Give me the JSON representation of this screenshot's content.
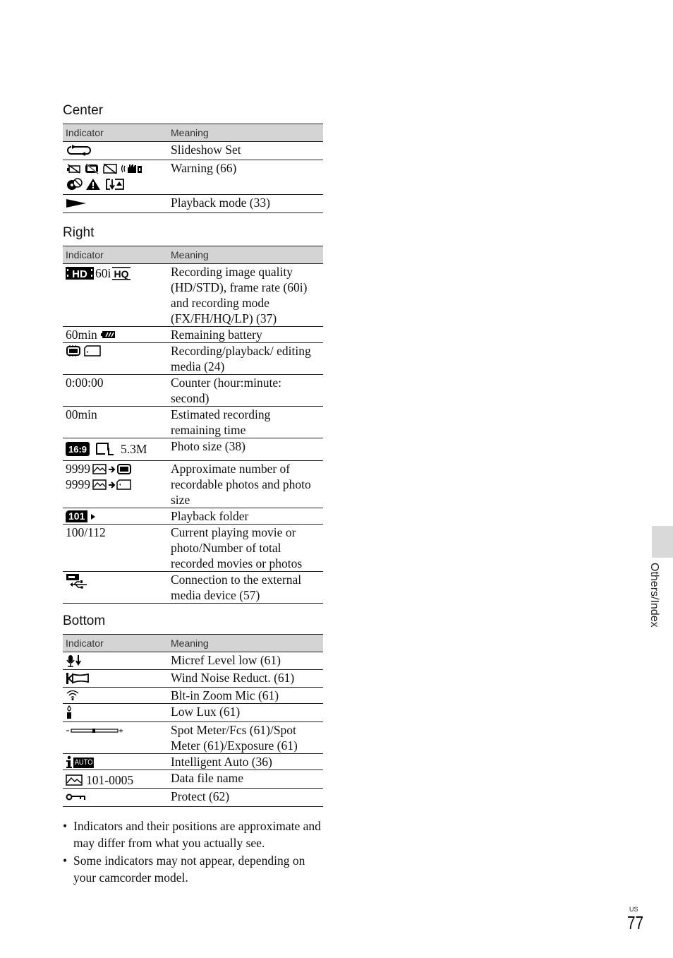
{
  "sections": {
    "center": {
      "title": "Center",
      "header": {
        "indicator": "Indicator",
        "meaning": "Meaning"
      },
      "rows": [
        {
          "icons": [
            "slideshow-repeat-icon"
          ],
          "meaning": "Slideshow Set"
        },
        {
          "icons": [
            "battery-warning-icon",
            "memory-warning-icon",
            "card-warning-icon",
            "camera-shake-warning-icon",
            "disc-warning-icon",
            "warning-triangle-icon",
            "media-warning-icon"
          ],
          "meaning": "Warning (66)"
        },
        {
          "icons": [
            "play-icon"
          ],
          "meaning": "Playback mode (33)"
        }
      ]
    },
    "right": {
      "title": "Right",
      "header": {
        "indicator": "Indicator",
        "meaning": "Meaning"
      },
      "rows": [
        {
          "text": "60i",
          "icons": [
            "hd-icon",
            "hq-mode-icon"
          ],
          "meaning": "Recording image quality (HD/STD), frame rate (60i) and recording mode (FX/FH/HQ/LP) (37)"
        },
        {
          "text": "60min",
          "icons": [
            "battery-icon"
          ],
          "meaning": "Remaining battery"
        },
        {
          "icons": [
            "internal-memory-icon",
            "memory-card-icon"
          ],
          "meaning": "Recording/playback/ editing media (24)"
        },
        {
          "text": "0:00:00",
          "meaning": "Counter (hour:minute: second)"
        },
        {
          "text": "00min",
          "meaning": "Estimated recording remaining time"
        },
        {
          "text": "5.3M",
          "icons": [
            "aspect-16-9-icon",
            "photo-size-l-icon"
          ],
          "meaning": "Photo size (38)"
        },
        {
          "lines": [
            "9999",
            "9999"
          ],
          "icons": [
            "photo-to-memory-icon",
            "photo-to-card-icon"
          ],
          "meaning": "Approximate number of recordable photos and photo size"
        },
        {
          "text": "101",
          "icons": [
            "folder-icon",
            "play-small-icon"
          ],
          "meaning": "Playback folder"
        },
        {
          "text": "100/112",
          "meaning": "Current playing movie or photo/Number of total recorded movies or photos"
        },
        {
          "icons": [
            "usb-external-media-icon"
          ],
          "meaning": "Connection to the external media device (57)"
        }
      ]
    },
    "bottom": {
      "title": "Bottom",
      "header": {
        "indicator": "Indicator",
        "meaning": "Meaning"
      },
      "rows": [
        {
          "icons": [
            "mic-level-low-icon"
          ],
          "meaning": "Micref Level low (61)"
        },
        {
          "icons": [
            "wind-noise-icon"
          ],
          "meaning": "Wind Noise Reduct. (61)"
        },
        {
          "icons": [
            "zoom-mic-icon"
          ],
          "meaning": "Blt-in Zoom Mic (61)"
        },
        {
          "icons": [
            "low-lux-candle-icon"
          ],
          "meaning": "Low Lux (61)"
        },
        {
          "icons": [
            "exposure-slider-icon"
          ],
          "meaning": "Spot Meter/Fcs (61)/Spot Meter (61)/Exposure (61)"
        },
        {
          "text": "AUTO",
          "icons": [
            "intelligent-auto-icon"
          ],
          "meaning": "Intelligent Auto (36)"
        },
        {
          "text": "101-0005",
          "icons": [
            "photo-file-icon"
          ],
          "meaning": "Data file name"
        },
        {
          "icons": [
            "protect-key-icon"
          ],
          "meaning": "Protect (62)"
        }
      ]
    }
  },
  "notes": [
    "Indicators and their positions are approximate and may differ from what you actually see.",
    "Some indicators may not appear, depending on your camcorder model."
  ],
  "side_tab": {
    "label": "Others/Index"
  },
  "page": {
    "region": "US",
    "number": "77"
  }
}
